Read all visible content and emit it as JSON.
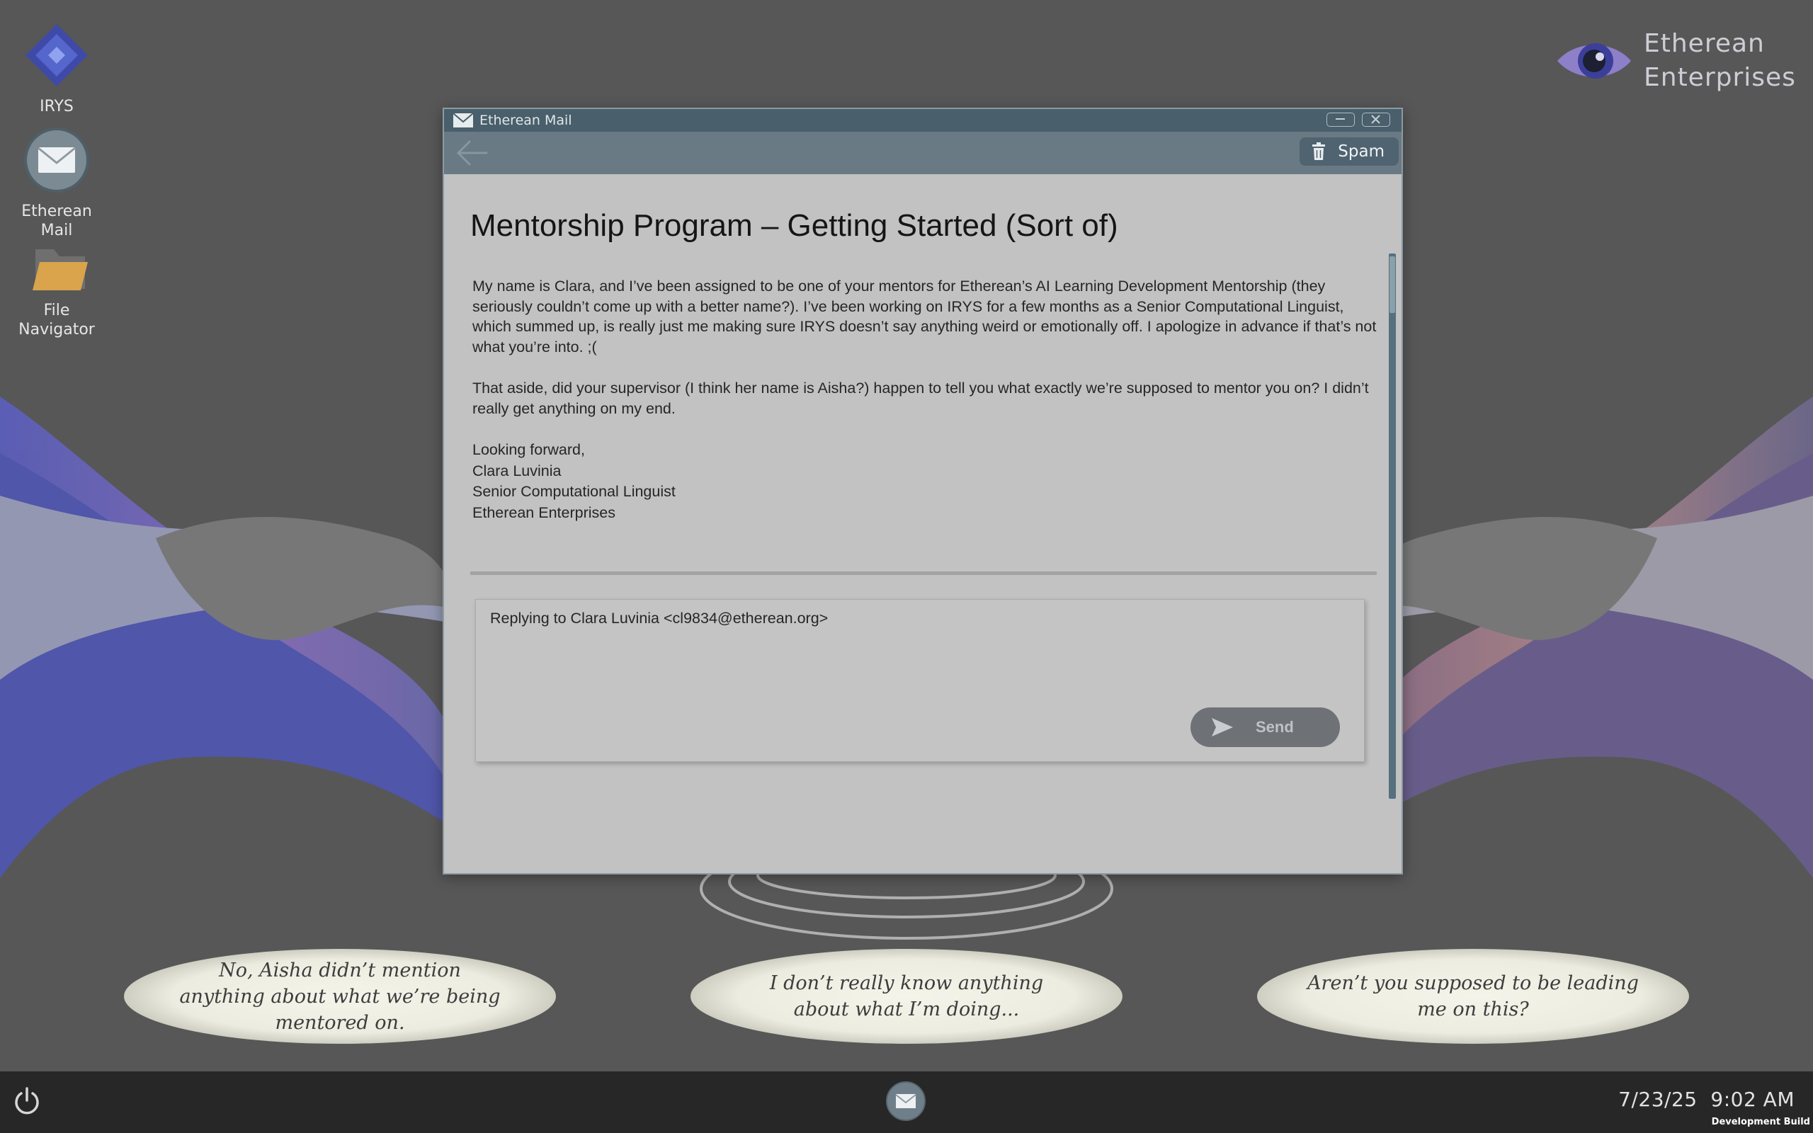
{
  "desktop": {
    "icons": [
      {
        "label": "IRYS",
        "icon": "irys-diamond-icon"
      },
      {
        "label": "Etherean Mail",
        "icon": "mail-envelope-icon"
      },
      {
        "label": "File Navigator",
        "icon": "folder-icon"
      }
    ],
    "logo": {
      "line1": "Etherean",
      "line2": "Enterprises",
      "icon": "eye-logo-icon"
    }
  },
  "mail_window": {
    "title": "Etherean Mail",
    "toolbar": {
      "back_icon": "back-arrow-icon",
      "spam_label": "Spam",
      "spam_icon": "trash-icon"
    },
    "subject": "Mentorship Program – Getting Started (Sort of)",
    "body": {
      "paragraph1": "My name is Clara, and I’ve been assigned to be one of your mentors for Etherean’s AI Learning Development Mentorship (they seriously couldn’t come up with a better name?). I’ve been working on IRYS for a few months as a Senior Computational Linguist, which summed up, is really just me making sure IRYS doesn’t say anything weird or emotionally off. I apologize in advance if that’s not what you’re into. ;(",
      "paragraph2": "That aside, did your supervisor (I think her name is Aisha?) happen to tell you what exactly we’re supposed to mentor you on? I didn’t really get anything on my end.",
      "signature": [
        "Looking forward,",
        "Clara Luvinia",
        "Senior Computational Linguist",
        "Etherean Enterprises"
      ]
    },
    "reply": {
      "replying_to": "Replying to Clara Luvinia <cl9834@etherean.org>",
      "send_label": "Send"
    }
  },
  "choices": [
    "No, Aisha didn’t mention anything about what we’re being mentored on.",
    "I don’t really know anything about what I’m doing...",
    "Aren’t you supposed to be leading me on this?"
  ],
  "taskbar": {
    "date": "7/23/25",
    "time": "9:02 AM",
    "build": "Development Build"
  },
  "colors": {
    "desktop_bg": "#575757",
    "titlebar": "#495f6b",
    "toolbar": "#697a84",
    "window_bg": "#c2c2c2",
    "taskbar": "#272727"
  }
}
